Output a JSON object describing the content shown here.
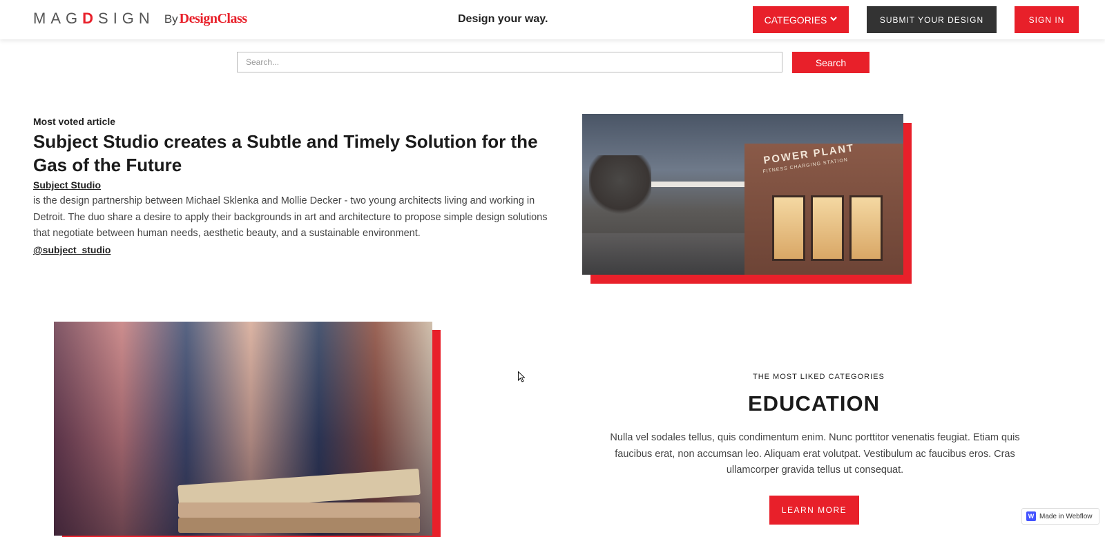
{
  "header": {
    "logo_mag": "MAG",
    "logo_d": "D",
    "logo_sign": "SIGN",
    "logo_by": "By",
    "logo_designclass": "DesignClass",
    "tagline": "Design your way.",
    "categories_label": "CATEGORIES",
    "categories_icon": "chevron-down-icon",
    "submit_label": "SUBMIT YOUR DESIGN",
    "signin_label": "SIGN IN"
  },
  "search": {
    "placeholder": "Search...",
    "value": "",
    "button_label": "Search"
  },
  "featured": {
    "eyebrow": "Most voted article",
    "title": "Subject Studio creates a Subtle and Timely Solution for the Gas of the Future",
    "author": "Subject Studio",
    "body": "is the design partnership between Michael Sklenka and Mollie Decker - two young architects living and working in Detroit. The duo share a desire to apply their backgrounds in art and architecture to propose simple design solutions that negotiate between human needs, aesthetic beauty, and a sustainable environment.",
    "handle": "@subject_studio",
    "image_sign": "POWER PLANT",
    "image_sign_sub": "FITNESS CHARGING STATION"
  },
  "category": {
    "eyebrow": "THE MOST LIKED CATEGORIES",
    "title": "EDUCATION",
    "body": "Nulla vel sodales tellus, quis condimentum enim. Nunc porttitor venenatis feugiat. Etiam quis faucibus erat, non accumsan leo. Aliquam erat volutpat. Vestibulum ac faucibus eros. Cras ullamcorper gravida tellus ut consequat.",
    "button_label": "LEARN MORE"
  },
  "badge": {
    "icon_letter": "W",
    "label": "Made in Webflow"
  },
  "colors": {
    "accent": "#e8202a",
    "dark_button": "#333333",
    "webflow_blue": "#4353ff"
  }
}
